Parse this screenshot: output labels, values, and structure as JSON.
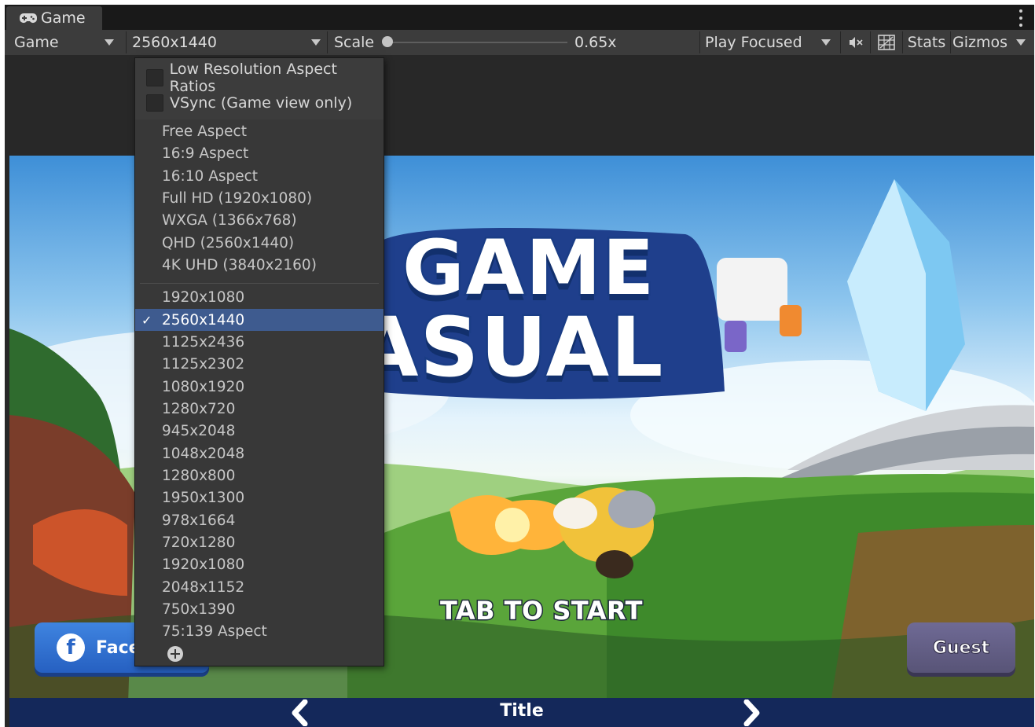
{
  "window": {
    "tab_label": "Game",
    "tab_icon": "gamepad-icon"
  },
  "toolbar": {
    "display_dropdown": "Game",
    "resolution_dropdown": "2560x1440",
    "scale_label": "Scale",
    "scale_value": "0.65x",
    "scale_fraction": 0.0,
    "play_mode_dropdown": "Play Focused",
    "mute_icon": "mute-audio-icon",
    "shortcut_icon": "shortcut-grid-icon",
    "stats_label": "Stats",
    "gizmos_label": "Gizmos"
  },
  "resolution_menu": {
    "options": [
      {
        "label": "Low Resolution Aspect Ratios",
        "checked": false
      },
      {
        "label": "VSync (Game view only)",
        "checked": false
      }
    ],
    "builtin_items": [
      "Free Aspect",
      "16:9 Aspect",
      "16:10 Aspect",
      "Full HD (1920x1080)",
      "WXGA (1366x768)",
      "QHD (2560x1440)",
      "4K UHD (3840x2160)"
    ],
    "custom_items": [
      "1920x1080",
      "2560x1440",
      "1125x2436",
      "1125x2302",
      "1080x1920",
      "1280x720",
      "945x2048",
      "1048x2048",
      "1280x800",
      "1950x1300",
      "978x1664",
      "720x1280",
      "1920x1080",
      "2048x1152",
      "750x1390",
      "75:139 Aspect"
    ],
    "selected_item": "2560x1440",
    "add_icon": "add-circle-icon"
  },
  "game": {
    "logo_line1": "GAME",
    "logo_line2": "ASUAL",
    "tap_to_start": "TAB TO START",
    "facebook_button": "Face",
    "guest_button": "Guest",
    "footer_title": "Title"
  }
}
